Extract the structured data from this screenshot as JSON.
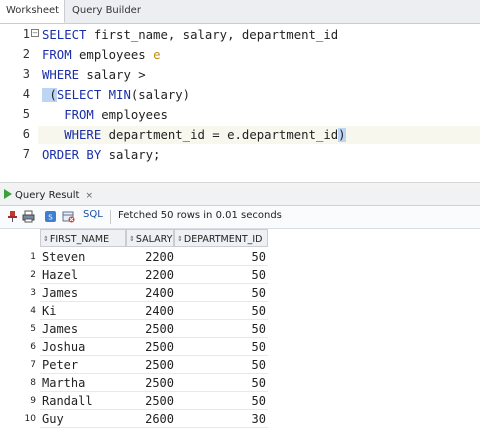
{
  "tabs": {
    "worksheet": "Worksheet",
    "query_builder": "Query Builder"
  },
  "editor": {
    "line_numbers": [
      "1",
      "2",
      "3",
      "4",
      "5",
      "6",
      "7"
    ],
    "lines": [
      [
        {
          "t": "SELECT",
          "k": "kw"
        },
        {
          "t": " first_name, salary, department_id",
          "k": "id"
        }
      ],
      [
        {
          "t": "FROM",
          "k": "kw"
        },
        {
          "t": " employees ",
          "k": "id"
        },
        {
          "t": "e",
          "k": "alias"
        }
      ],
      [
        {
          "t": "WHERE",
          "k": "kw"
        },
        {
          "t": " salary >",
          "k": "id"
        }
      ],
      [
        {
          "t": " (",
          "k": "paren"
        },
        {
          "t": "SELECT",
          "k": "kw"
        },
        {
          "t": " ",
          "k": "id"
        },
        {
          "t": "MIN",
          "k": "kw"
        },
        {
          "t": "(salary)",
          "k": "id"
        }
      ],
      [
        {
          "t": "   ",
          "k": "id"
        },
        {
          "t": "FROM",
          "k": "kw"
        },
        {
          "t": " employees",
          "k": "id"
        }
      ],
      [
        {
          "t": "   ",
          "k": "id"
        },
        {
          "t": "WHERE",
          "k": "kw"
        },
        {
          "t": " department_id = e.department_id",
          "k": "id"
        },
        {
          "t": ")",
          "k": "paren"
        }
      ],
      [
        {
          "t": "ORDER BY",
          "k": "kw"
        },
        {
          "t": " salary;",
          "k": "id"
        }
      ]
    ]
  },
  "results": {
    "tab_label": "Query Result",
    "close_glyph": "×",
    "sql_label": "SQL",
    "fetch_status": "Fetched 50 rows in 0.01 seconds",
    "columns": [
      "FIRST_NAME",
      "SALARY",
      "DEPARTMENT_ID"
    ],
    "rows": [
      [
        "1",
        "Steven",
        "2200",
        "50"
      ],
      [
        "2",
        "Hazel",
        "2200",
        "50"
      ],
      [
        "3",
        "James",
        "2400",
        "50"
      ],
      [
        "4",
        "Ki",
        "2400",
        "50"
      ],
      [
        "5",
        "James",
        "2500",
        "50"
      ],
      [
        "6",
        "Joshua",
        "2500",
        "50"
      ],
      [
        "7",
        "Peter",
        "2500",
        "50"
      ],
      [
        "8",
        "Martha",
        "2500",
        "50"
      ],
      [
        "9",
        "Randall",
        "2500",
        "50"
      ],
      [
        "10",
        "Guy",
        "2600",
        "30"
      ]
    ]
  },
  "colors": {
    "keyword": "#1a2ea8",
    "alias": "#c28a1a",
    "bracket_highlight": "#bdd5f3",
    "run_icon": "#3ba03b"
  }
}
